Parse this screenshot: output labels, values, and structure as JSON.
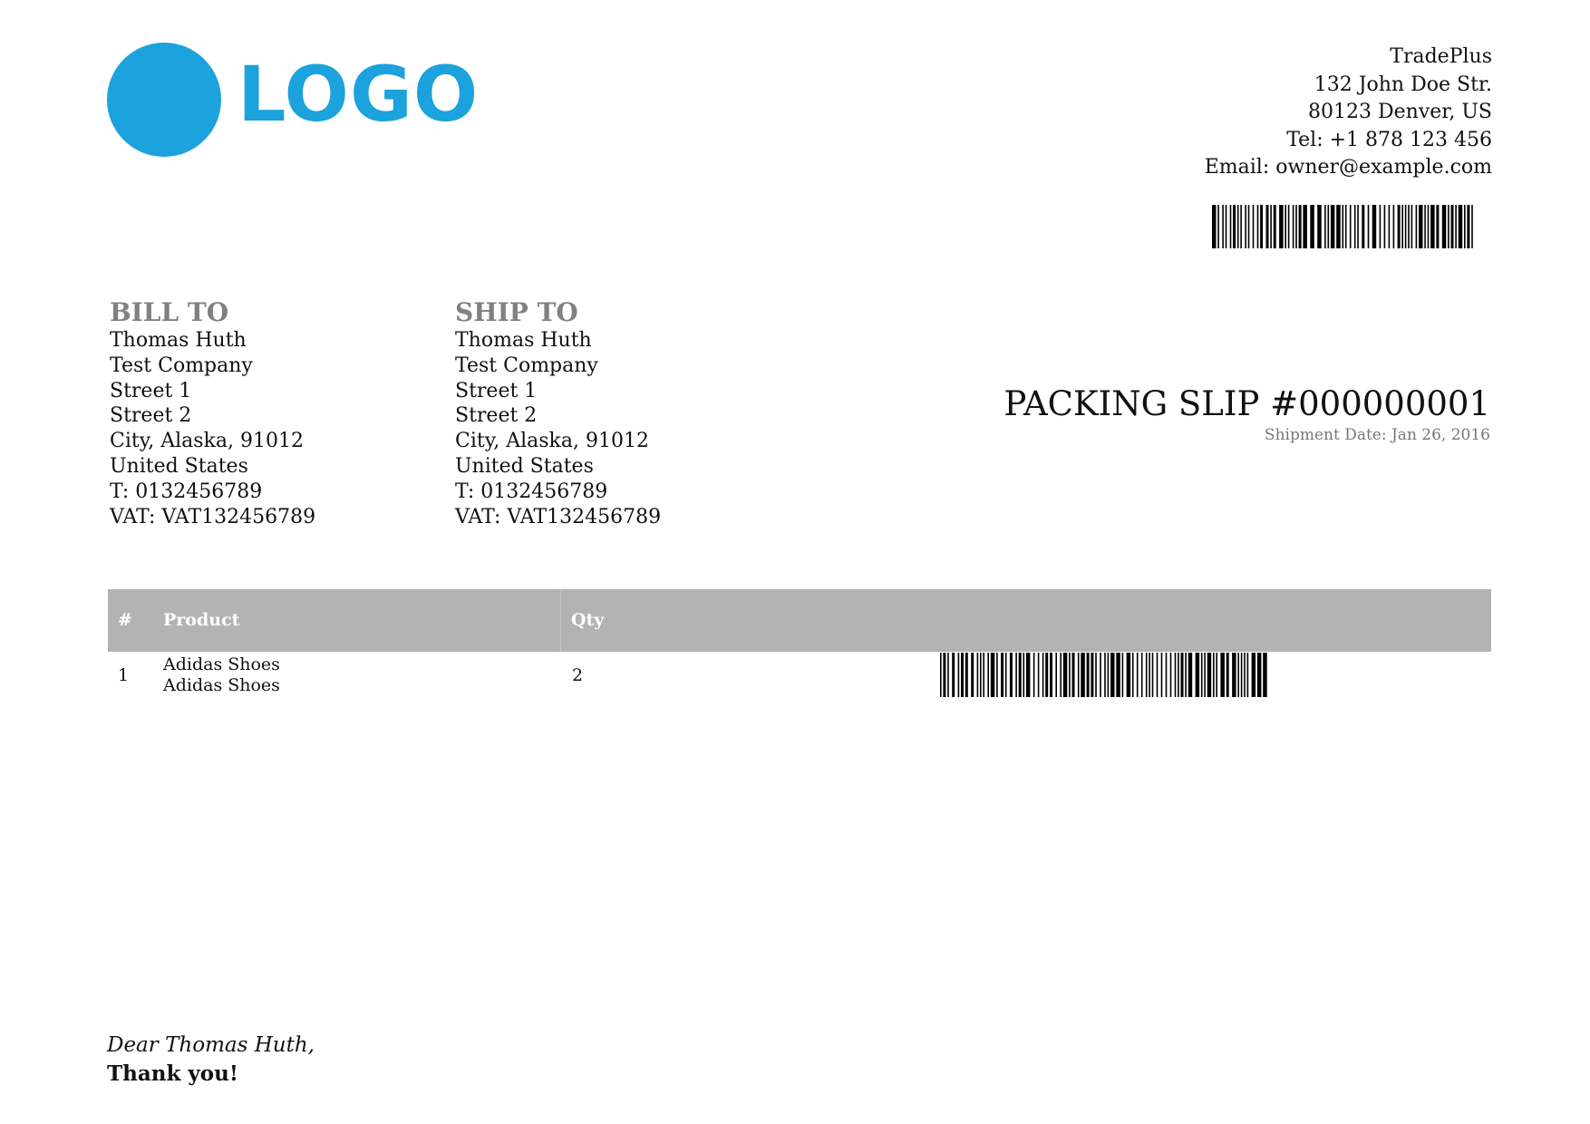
{
  "logo": {
    "text": "LOGO",
    "color": "#1ca2dc"
  },
  "company": {
    "name": "TradePlus",
    "street": "132 John Doe Str.",
    "city": "80123 Denver, US",
    "tel": "Tel: +1 878 123 456",
    "email": "Email: owner@example.com"
  },
  "bill_to": {
    "heading": "BILL TO",
    "name": "Thomas Huth",
    "company": "Test Company",
    "street1": "Street 1",
    "street2": "Street 2",
    "city": "City, Alaska, 91012",
    "country": "United States",
    "phone": "T: 0132456789",
    "vat": "VAT: VAT132456789"
  },
  "ship_to": {
    "heading": "SHIP TO",
    "name": "Thomas Huth",
    "company": "Test Company",
    "street1": "Street 1",
    "street2": "Street 2",
    "city": "City, Alaska, 91012",
    "country": "United States",
    "phone": "T: 0132456789",
    "vat": "VAT: VAT132456789"
  },
  "slip": {
    "title": "PACKING SLIP #000000001",
    "shipment_date": "Shipment Date: Jan 26, 2016"
  },
  "items_table": {
    "headers": {
      "num": "#",
      "product": "Product",
      "qty": "Qty"
    },
    "header_bg": "#b3b3b3",
    "rows": [
      {
        "num": "1",
        "product": "Adidas Shoes",
        "sku": "Adidas Shoes",
        "qty": "2"
      }
    ]
  },
  "footer": {
    "greeting": "Dear Thomas Huth,",
    "thanks": "Thank you!"
  }
}
